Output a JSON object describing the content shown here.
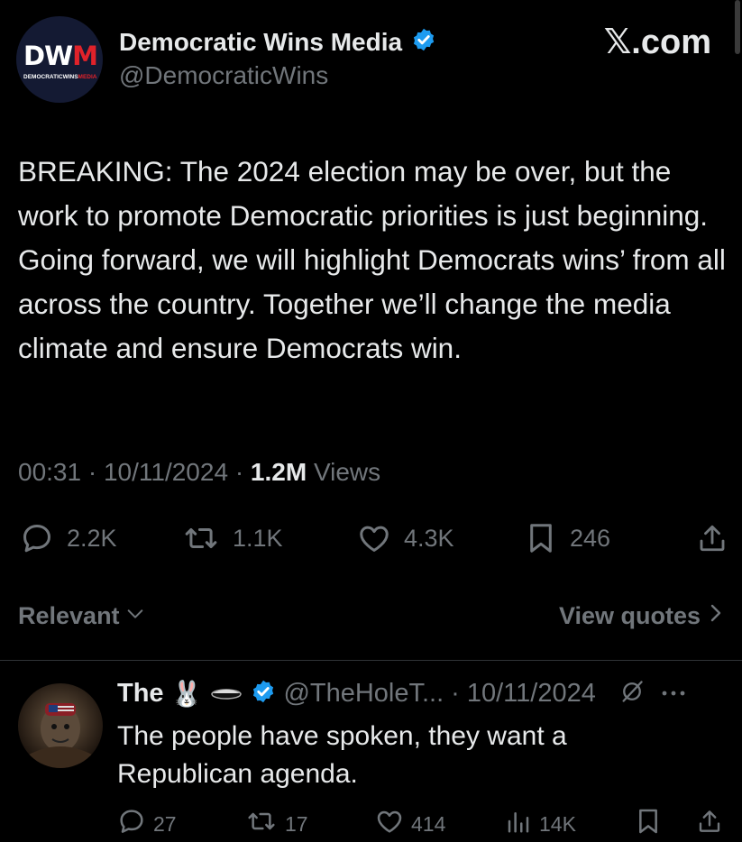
{
  "account": {
    "avatar_logo": "DWM",
    "avatar_logo_part1": "DW",
    "avatar_logo_part2": "M",
    "avatar_subtext_part1": "DEMOCRATICWINS",
    "avatar_subtext_part2": "MEDIA",
    "display_name": "Democratic Wins Media",
    "handle": "@DemocraticWins",
    "verified": true
  },
  "watermark": "𝕏.com",
  "tweet": {
    "text": "BREAKING: The 2024 election may be over, but the work to promote Democratic priorities is just beginning. Going forward, we will highlight Democrats wins’ from all across the country. Together we’ll change the media climate and ensure Democrats win.",
    "time": "00:31",
    "date": "10/11/2024",
    "views_count": "1.2M",
    "views_label": "Views",
    "separator": "·"
  },
  "actions": {
    "replies": "2.2K",
    "reposts": "1.1K",
    "likes": "4.3K",
    "bookmarks": "246"
  },
  "sort": {
    "label": "Relevant",
    "view_quotes": "View quotes"
  },
  "reply": {
    "name": "The",
    "emoji": "🐰",
    "handle": "@TheHoleT...",
    "separator": "·",
    "date": "10/11/2024",
    "text": "The people have spoken, they want a Republican agenda.",
    "replies": "27",
    "reposts": "17",
    "likes": "414",
    "views": "14K"
  },
  "colors": {
    "background": "#000000",
    "text_primary": "#e7e9ea",
    "text_secondary": "#71767b",
    "verified_blue": "#1d9bf0",
    "brand_red": "#e0222a"
  }
}
